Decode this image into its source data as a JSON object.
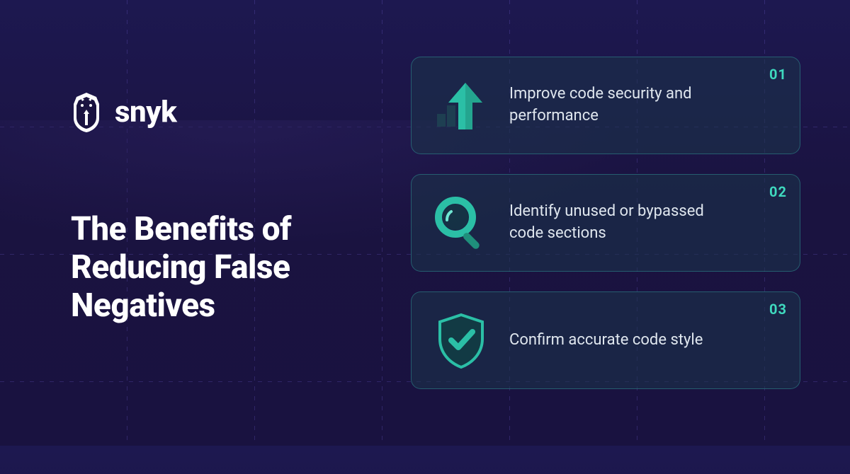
{
  "brand": {
    "name": "snyk"
  },
  "title": "The Benefits of Reducing False Negatives",
  "cards": [
    {
      "num": "01",
      "icon": "arrow-up-icon",
      "text": "Improve code security and performance"
    },
    {
      "num": "02",
      "icon": "magnifier-icon",
      "text": "Identify unused or bypassed code sections"
    },
    {
      "num": "03",
      "icon": "shield-check-icon",
      "text": "Confirm accurate code style"
    }
  ],
  "colors": {
    "accent": "#3fd9be",
    "card_bg": "rgba(28,52,74,0.55)",
    "text": "#dfe6ee"
  }
}
